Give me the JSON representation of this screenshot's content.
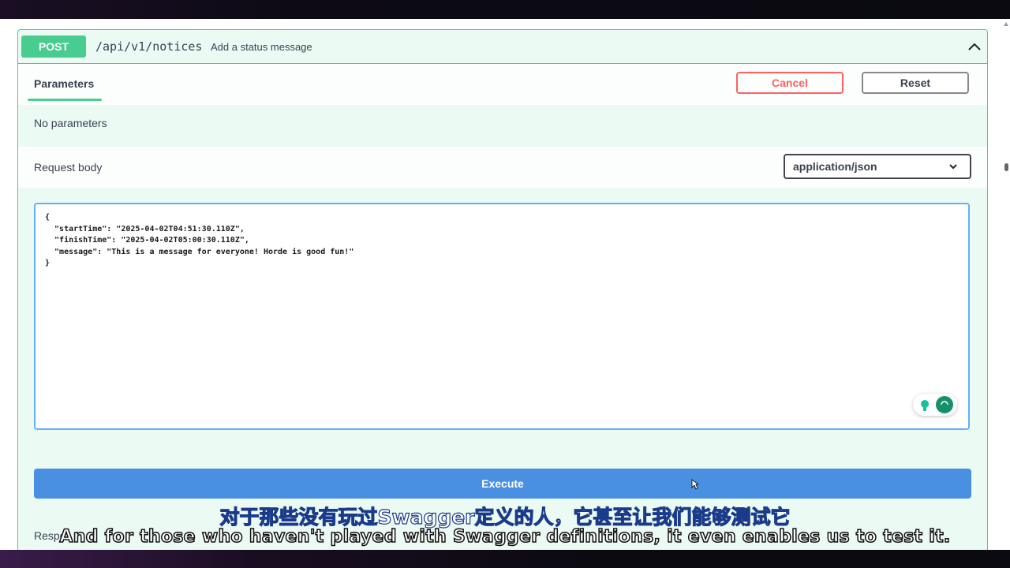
{
  "operation": {
    "method": "POST",
    "path": "/api/v1/notices",
    "description": "Add a status message"
  },
  "tabs": {
    "parameters_label": "Parameters",
    "cancel_label": "Cancel",
    "reset_label": "Reset"
  },
  "parameters": {
    "empty_text": "No parameters"
  },
  "request_body": {
    "label": "Request body",
    "content_type": "application/json",
    "json_text": "{\n  \"startTime\": \"2025-04-02T04:51:30.110Z\",\n  \"finishTime\": \"2025-04-02T05:00:30.110Z\",\n  \"message\": \"This is a message for everyone! Horde is good fun!\"\n}"
  },
  "execute_label": "Execute",
  "responses_label": "Respo",
  "subtitles": {
    "chinese": "对于那些没有玩过Swagger定义的人，它甚至让我们能够测试它",
    "english": "And for those who haven't played with Swagger definitions, it even enables us to test it."
  },
  "colors": {
    "post_green": "#49cc90",
    "execute_blue": "#4990e2",
    "cancel_red": "#ff6060",
    "editor_border": "#61affe"
  },
  "icons": {
    "collapse": "chevron-up-icon",
    "select": "chevron-down-icon",
    "grammar": "grammarly-icon",
    "cursor": "mouse-pointer-icon"
  }
}
